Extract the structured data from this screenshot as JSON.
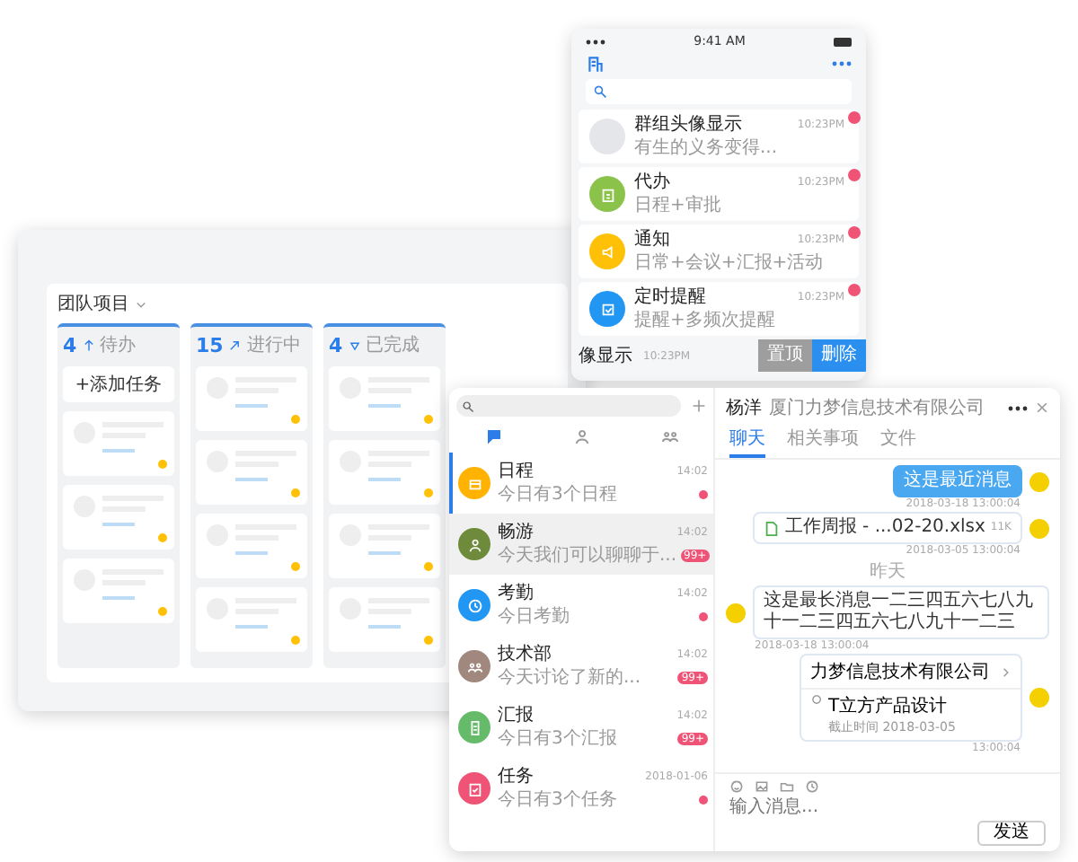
{
  "kanban": {
    "title": "团队项目",
    "columns": [
      {
        "count": "4",
        "kind": "up",
        "label": "待办",
        "add_task": "+添加任务",
        "cards": [
          {
            "starred": true
          },
          {
            "starred": true
          },
          {
            "starred": true
          }
        ]
      },
      {
        "count": "15",
        "kind": "progress",
        "label": "进行中",
        "cards": [
          {
            "starred": true
          },
          {
            "starred": true
          },
          {
            "starred": true
          },
          {
            "starred": true
          }
        ]
      },
      {
        "count": "4",
        "kind": "down",
        "label": "已完成",
        "cards": [
          {
            "starred": true
          },
          {
            "starred": true
          },
          {
            "starred": true
          },
          {
            "starred": true
          }
        ]
      }
    ]
  },
  "phone": {
    "status_time": "9:41 AM",
    "items": [
      {
        "kind": "group",
        "color": "#e4e6e9",
        "title": "群组头像显示",
        "subtitle": "有生的义务变得...",
        "time": "10:23PM"
      },
      {
        "kind": "todo",
        "color": "#8bc34a",
        "title": "代办",
        "subtitle": "日程+审批",
        "time": "10:23PM"
      },
      {
        "kind": "notice",
        "color": "#ffc107",
        "title": "通知",
        "subtitle": "日常+会议+汇报+活动",
        "time": "10:23PM"
      },
      {
        "kind": "reminder",
        "color": "#2196f3",
        "title": "定时提醒",
        "subtitle": "提醒+多频次提醒",
        "time": "10:23PM"
      }
    ],
    "swiped_row": {
      "title": "像显示",
      "time": "10:23PM",
      "actions": [
        {
          "kind": "gray",
          "label": "置顶"
        },
        {
          "kind": "blue",
          "label": "删除"
        }
      ]
    }
  },
  "chat": {
    "tabs": [
      {
        "kind": "chat",
        "selected": true
      },
      {
        "kind": "contact",
        "selected": false
      },
      {
        "kind": "group",
        "selected": false
      }
    ],
    "conversations": [
      {
        "kind": "calendar",
        "color": "#ffb300",
        "title": "日程",
        "preview": "今日有3个日程",
        "time": "14:02",
        "selected": true,
        "hovered": false
      },
      {
        "kind": "person",
        "color": "#6d8b3a",
        "title": "畅游",
        "preview": "今天我们可以聊聊于...",
        "time": "14:02",
        "badge": "99+",
        "selected": false,
        "hovered": true
      },
      {
        "kind": "clock",
        "color": "#2196f3",
        "title": "考勤",
        "preview": "今日考勤",
        "time": "14:02",
        "selected": false,
        "hovered": false
      },
      {
        "kind": "team",
        "color": "#a1887f",
        "title": "技术部",
        "preview": "今天讨论了新的...",
        "time": "14:02",
        "badge": "99+",
        "selected": false,
        "hovered": false
      },
      {
        "kind": "report",
        "color": "#66bb6a",
        "title": "汇报",
        "preview": "今日有3个汇报",
        "time": "14:02",
        "badge": "99+",
        "selected": false,
        "hovered": false
      },
      {
        "kind": "task",
        "color": "#ef5375",
        "title": "任务",
        "preview": "今日有3个任务",
        "time": "2018-01-06",
        "selected": false,
        "hovered": false
      }
    ],
    "header": {
      "name": "杨洋",
      "company": "厦门力梦信息技术有限公司"
    },
    "detail_tabs": [
      {
        "label": "聊天",
        "selected": true
      },
      {
        "label": "相关事项",
        "selected": false
      },
      {
        "label": "文件",
        "selected": false
      }
    ],
    "messages": [
      {
        "kind": "text_out",
        "text": "这是最近消息",
        "time": "2018-03-18 13:00:04"
      },
      {
        "kind": "file_out",
        "text": "工作周报 - ...02-20.xlsx",
        "size": "11K",
        "time": "2018-03-05 13:00:04"
      },
      {
        "kind": "divider",
        "text": "昨天"
      },
      {
        "kind": "text_in",
        "text": "这是最长消息一二三四五六七八九十一二三四五六七八九十一二三",
        "time": "2018-03-18 13:00:04"
      },
      {
        "kind": "card_out",
        "title": "力梦信息技术有限公司",
        "task": "T立方产品设计",
        "deadline": "截止时间 2018-03-05",
        "time": "13:00:04"
      }
    ],
    "input_placeholder": "输入消息...",
    "send": "发送"
  }
}
